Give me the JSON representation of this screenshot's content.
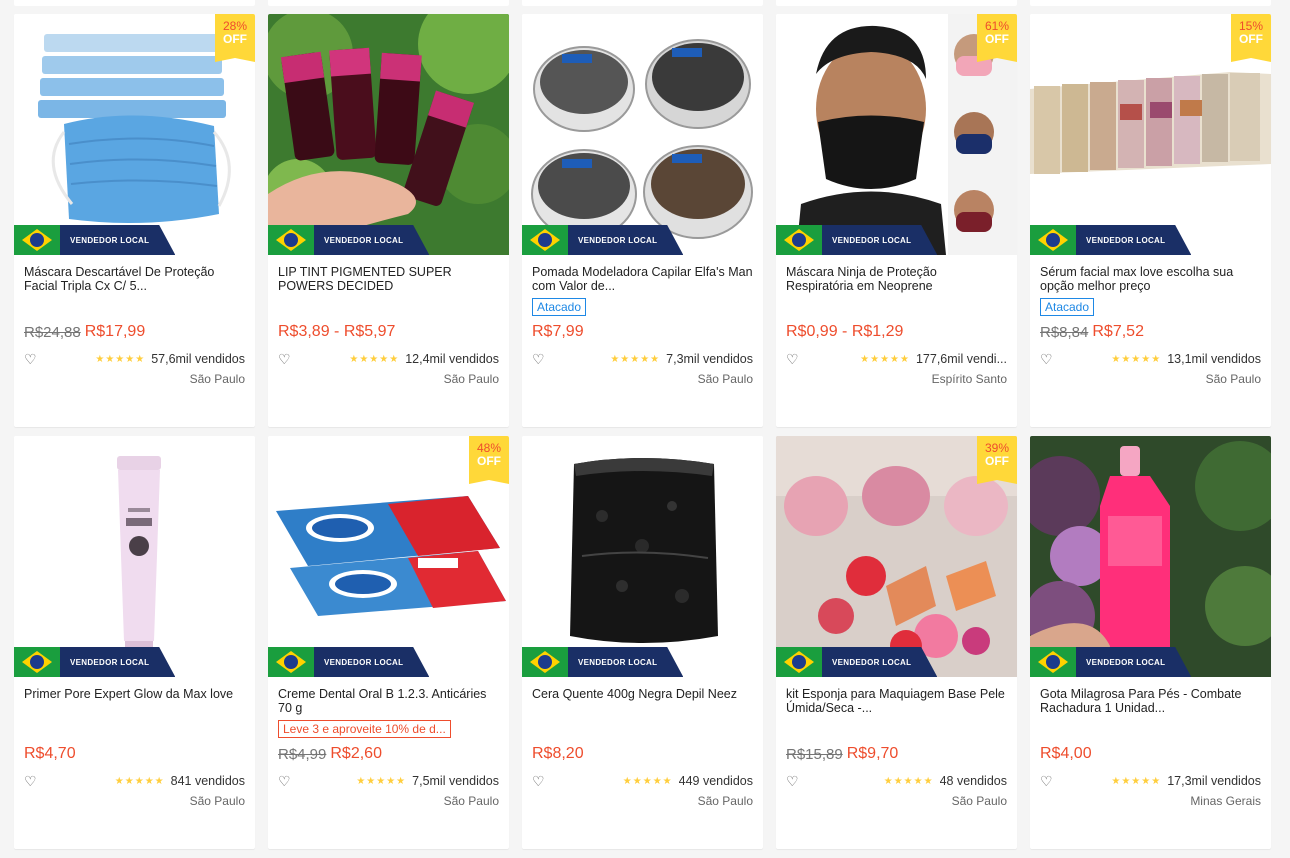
{
  "badge": {
    "local_label": "VENDEDOR LOCAL",
    "off_label": "OFF"
  },
  "products": [
    {
      "name": "Máscara Descartável De Proteção Facial Tripla Cx C/ 5...",
      "discount": "28%",
      "tag": "",
      "original_price": "R$24,88",
      "price": "R$17,99",
      "sold": "57,6mil vendidos",
      "location": "São Paulo",
      "image": "blue-face-masks"
    },
    {
      "name": "LIP TINT PIGMENTED SUPER POWERS DECIDED",
      "discount": "",
      "tag": "",
      "original_price": "",
      "price": "R$3,89 - R$5,97",
      "sold": "12,4mil vendidos",
      "location": "São Paulo",
      "image": "lip-tint-bottles"
    },
    {
      "name": "Pomada Modeladora Capilar Elfa's Man com Valor de...",
      "discount": "",
      "tag": "Atacado",
      "original_price": "",
      "price": "R$7,99",
      "sold": "7,3mil vendidos",
      "location": "São Paulo",
      "image": "hair-pomade-jars"
    },
    {
      "name": "Máscara Ninja de Proteção Respiratória em Neoprene",
      "discount": "61%",
      "tag": "",
      "original_price": "",
      "price": "R$0,99 - R$1,29",
      "sold": "177,6mil vendi...",
      "location": "Espírito Santo",
      "image": "neoprene-masks"
    },
    {
      "name": "Sérum facial max love escolha sua opção melhor preço",
      "discount": "15%",
      "tag": "Atacado",
      "original_price": "R$8,84",
      "price": "R$7,52",
      "sold": "13,1mil vendidos",
      "location": "São Paulo",
      "image": "serum-boxes"
    },
    {
      "name": "Primer Pore Expert Glow da Max love",
      "discount": "",
      "tag": "",
      "original_price": "",
      "price": "R$4,70",
      "sold": "841 vendidos",
      "location": "São Paulo",
      "image": "primer-tube"
    },
    {
      "name": "Creme Dental Oral B 1.2.3. Anticáries 70 g",
      "discount": "48%",
      "tag": "Leve 3 e aproveite 10% de d...",
      "tag_style": "red",
      "original_price": "R$4,99",
      "price": "R$2,60",
      "sold": "7,5mil vendidos",
      "location": "São Paulo",
      "image": "toothpaste-boxes"
    },
    {
      "name": "Cera Quente 400g Negra Depil Neez",
      "discount": "",
      "tag": "",
      "original_price": "",
      "price": "R$8,20",
      "sold": "449 vendidos",
      "location": "São Paulo",
      "image": "black-wax-bag"
    },
    {
      "name": "kit Esponja para Maquiagem Base Pele Úmida/Seca -...",
      "discount": "39%",
      "tag": "",
      "original_price": "R$15,89",
      "price": "R$9,70",
      "sold": "48 vendidos",
      "location": "São Paulo",
      "image": "makeup-sponges"
    },
    {
      "name": "Gota Milagrosa Para Pés - Combate Rachadura 1 Unidad...",
      "discount": "",
      "tag": "",
      "original_price": "",
      "price": "R$4,00",
      "sold": "17,3mil vendidos",
      "location": "Minas Gerais",
      "image": "pink-dropper-bottle"
    }
  ]
}
